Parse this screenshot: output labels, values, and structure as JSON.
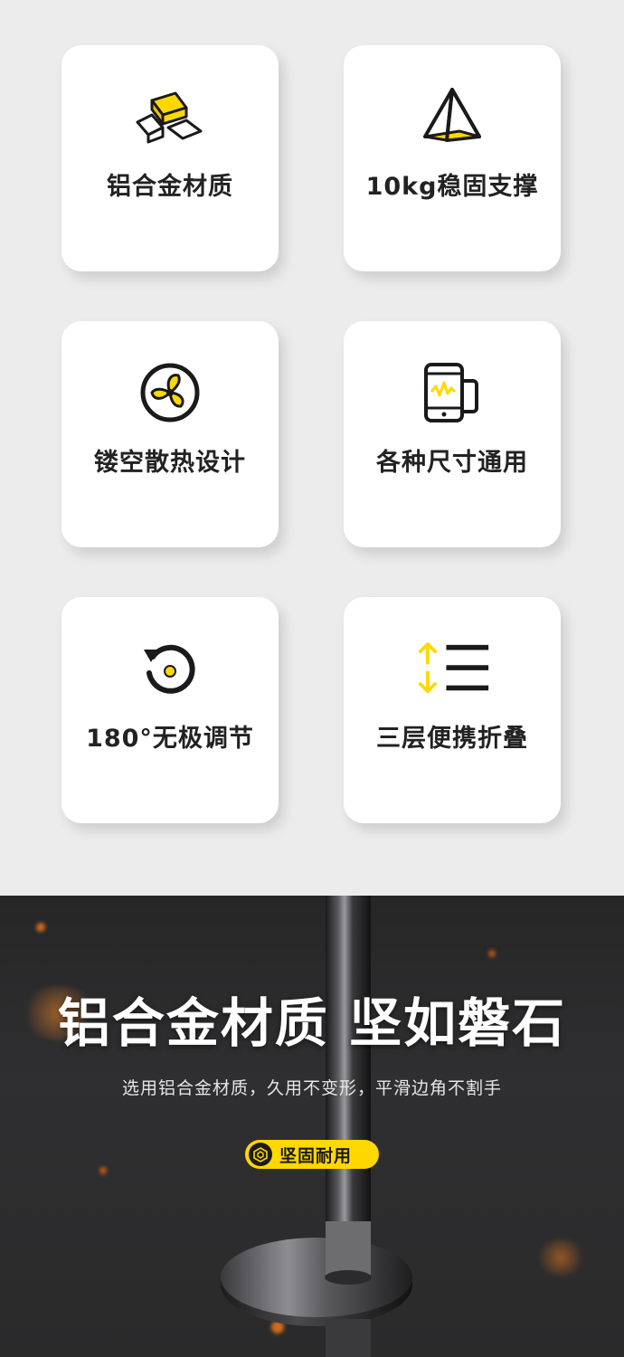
{
  "features": [
    {
      "label": "铝合金材质",
      "icon": "gold-bars-icon"
    },
    {
      "label": "10kg稳固支撑",
      "icon": "pyramid-icon"
    },
    {
      "label": "镂空散热设计",
      "icon": "fan-icon"
    },
    {
      "label": "各种尺寸通用",
      "icon": "phone-tablet-icon"
    },
    {
      "label": "180°无极调节",
      "icon": "rotate-icon"
    },
    {
      "label": "三层便携折叠",
      "icon": "fold-layers-icon"
    }
  ],
  "hero": {
    "title": "铝合金材质 坚如磐石",
    "subtitle": "选用铝合金材质，久用不变形，平滑边角不割手",
    "badge": "坚固耐用",
    "badge_icon": "cube-icon"
  },
  "colors": {
    "accent": "#ffd800",
    "icon_dark": "#1a1a1a",
    "card": "#ffffff",
    "background": "#ececec",
    "hero_dark": "#2a2a2b"
  }
}
